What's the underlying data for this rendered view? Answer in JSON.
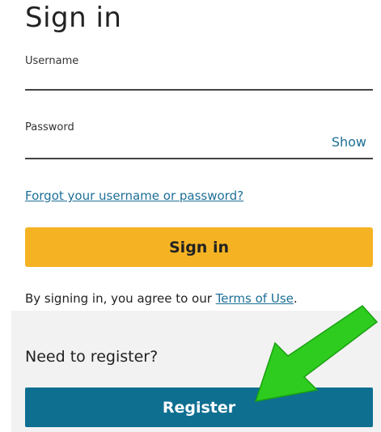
{
  "signin": {
    "title": "Sign in",
    "username_label": "Username",
    "username_value": "",
    "password_label": "Password",
    "password_value": "",
    "show_label": "Show",
    "forgot_link": "Forgot your username or password?",
    "signin_button": "Sign in",
    "agree_prefix": "By signing in, you agree to our ",
    "terms_link": "Terms of Use",
    "agree_suffix": "."
  },
  "register": {
    "heading": "Need to register?",
    "button": "Register"
  },
  "colors": {
    "accent_yellow": "#f5b324",
    "register_blue": "#0f6f91",
    "link_blue": "#1d6f96",
    "panel_gray": "#f2f2f2",
    "arrow_green": "#2ecc1f"
  },
  "icons": {
    "annotation": "green-arrow-icon"
  }
}
